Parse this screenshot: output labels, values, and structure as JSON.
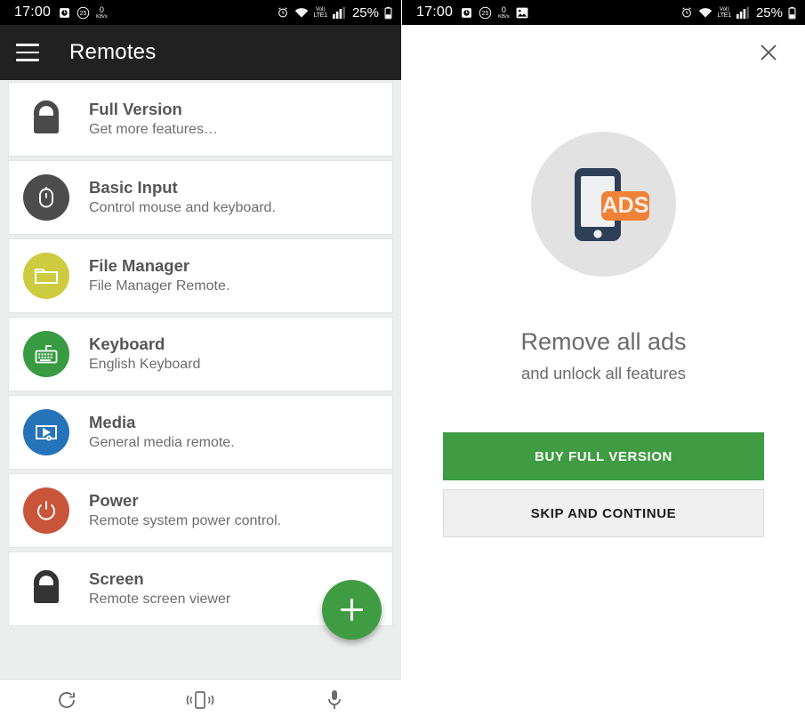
{
  "statusbar": {
    "time": "17:00",
    "net_speed_value": "0",
    "net_speed_unit": "KB/s",
    "badge_count": "25",
    "volte_top": "VoI)",
    "volte_bottom": "LTE1",
    "battery_percent": "25%",
    "icons_left": [
      "clock-icon",
      "notification-count-badge",
      "data-speed-indicator"
    ],
    "icons_left_right_panel": [
      "clock-icon",
      "notification-count-badge",
      "data-speed-indicator",
      "image-icon"
    ],
    "icons_right": [
      "alarm-icon",
      "wifi-icon",
      "volte-icon",
      "signal-bars-icon",
      "battery-icon"
    ]
  },
  "appbar": {
    "menu_icon": "hamburger-menu-icon",
    "title": "Remotes"
  },
  "remotes": [
    {
      "title": "Full Version",
      "subtitle": "Get more features…",
      "icon": "lock-icon",
      "icon_style": "plain",
      "color": "#4a4a4a"
    },
    {
      "title": "Basic Input",
      "subtitle": "Control mouse and keyboard.",
      "icon": "mouse-icon",
      "icon_style": "circle",
      "color": "#4c4c4c"
    },
    {
      "title": "File Manager",
      "subtitle": "File Manager Remote.",
      "icon": "folder-icon",
      "icon_style": "circle",
      "color": "#cdcb40"
    },
    {
      "title": "Keyboard",
      "subtitle": "English Keyboard",
      "icon": "keyboard-icon",
      "icon_style": "circle",
      "color": "#389b41"
    },
    {
      "title": "Media",
      "subtitle": "General media remote.",
      "icon": "media-play-icon",
      "icon_style": "circle",
      "color": "#2573b8"
    },
    {
      "title": "Power",
      "subtitle": "Remote system power control.",
      "icon": "power-icon",
      "icon_style": "circle",
      "color": "#c8553a"
    },
    {
      "title": "Screen",
      "subtitle": "Remote screen viewer",
      "icon": "lock-icon",
      "icon_style": "plain",
      "color": "#333333"
    }
  ],
  "fab": {
    "icon": "plus-icon",
    "color": "#3f9c42",
    "label": "Add remote"
  },
  "bottombar": {
    "items": [
      {
        "icon": "refresh-icon",
        "label": "Refresh"
      },
      {
        "icon": "device-vibrate-icon",
        "label": "Connect device"
      },
      {
        "icon": "microphone-icon",
        "label": "Voice"
      }
    ]
  },
  "promo": {
    "close_icon": "close-icon",
    "art_icon": "phone-ads-icon",
    "art_badge_text": "ADS",
    "art_circle_color": "#e2e2e2",
    "art_phone_color": "#2e3f58",
    "art_badge_color": "#ef8236",
    "headline": "Remove all ads",
    "subheadline": "and unlock all features",
    "primary_button": "BUY FULL VERSION",
    "secondary_button": "SKIP AND CONTINUE",
    "primary_color": "#3f9c42",
    "secondary_color": "#f0f0f0"
  }
}
